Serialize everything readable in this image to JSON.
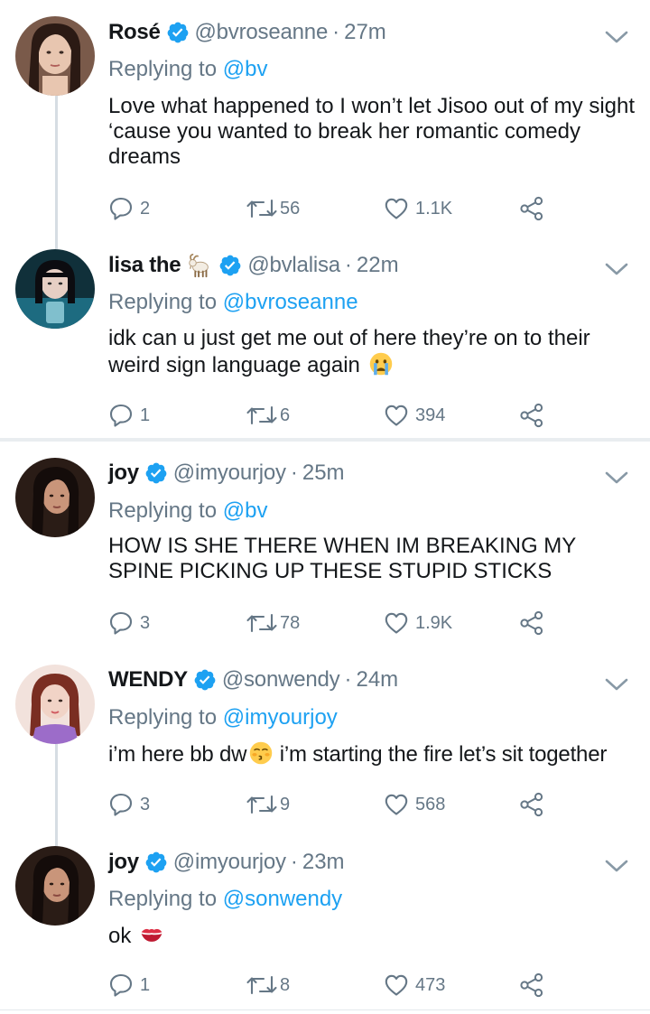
{
  "colors": {
    "accent": "#1da1f2",
    "secondary_text": "#657786",
    "primary_text": "#14171a",
    "like_red": "#e0245e"
  },
  "tweets": [
    {
      "name": "Rosé",
      "name_emoji": "",
      "verified": true,
      "handle": "@bvroseanne",
      "time": "27m",
      "replying_label": "Replying to",
      "replying_to": "@bv",
      "text": "Love what happened to I won’t let Jisoo out of my sight ‘cause you wanted to break her romantic comedy dreams",
      "text_emoji": "",
      "replies": "2",
      "retweets": "56",
      "likes": "1.1K"
    },
    {
      "name": "lisa the",
      "name_emoji": "goat-emoji",
      "verified": true,
      "handle": "@bvlalisa",
      "time": "22m",
      "replying_label": "Replying to",
      "replying_to": "@bvroseanne",
      "text": "idk can u just get me out of here they’re on to their weird sign language again",
      "text_emoji": "crying-face-emoji",
      "replies": "1",
      "retweets": "6",
      "likes": "394"
    },
    {
      "name": "joy",
      "name_emoji": "",
      "verified": true,
      "handle": "@imyourjoy",
      "time": "25m",
      "replying_label": "Replying to",
      "replying_to": "@bv",
      "text": "HOW IS SHE THERE WHEN IM BREAKING MY SPINE PICKING UP THESE STUPID STICKS",
      "text_emoji": "",
      "replies": "3",
      "retweets": "78",
      "likes": "1.9K"
    },
    {
      "name": "WENDY",
      "name_emoji": "",
      "verified": true,
      "handle": "@sonwendy",
      "time": "24m",
      "replying_label": "Replying to",
      "replying_to": "@imyourjoy",
      "text_a": "i’m here bb dw",
      "text_b": " i’m starting the fire let’s sit together",
      "text_emoji": "kissing-face-emoji",
      "replies": "3",
      "retweets": "9",
      "likes": "568"
    },
    {
      "name": "joy",
      "name_emoji": "",
      "verified": true,
      "handle": "@imyourjoy",
      "time": "23m",
      "replying_label": "Replying to",
      "replying_to": "@sonwendy",
      "text": "ok",
      "text_emoji": "kiss-mark-emoji",
      "replies": "1",
      "retweets": "8",
      "likes": "473"
    }
  ],
  "separator_dot": "·"
}
